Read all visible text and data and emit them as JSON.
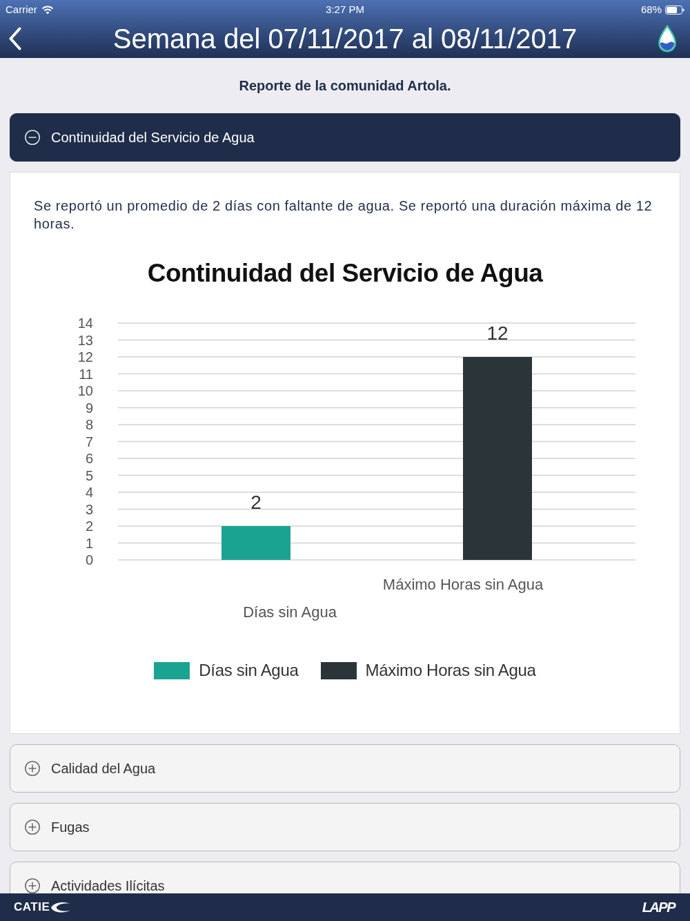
{
  "status_bar": {
    "carrier": "Carrier",
    "time": "3:27 PM",
    "battery": "68%"
  },
  "nav_bar": {
    "title": "Semana del 07/11/2017 al 08/11/2017"
  },
  "subtitle": "Reporte de la comunidad Artola.",
  "sections": [
    {
      "title": "Continuidad del Servicio de Agua",
      "expanded": true,
      "summary": "Se reportó un promedio de 2 días con faltante de agua. Se reportó una duración máxima de 12 horas.",
      "chart_data": {
        "type": "bar",
        "title": "Continuidad del Servicio de Agua",
        "categories": [
          "Días sin Agua",
          "Máximo Horas sin Agua"
        ],
        "series": [
          {
            "name": "Días sin Agua",
            "color": "#1ba392",
            "values": [
              2,
              null
            ]
          },
          {
            "name": "Máximo Horas sin Agua",
            "color": "#2b3539",
            "values": [
              null,
              12
            ]
          }
        ],
        "ylim": [
          0,
          14
        ],
        "yticks": [
          0,
          1,
          2,
          3,
          4,
          5,
          6,
          7,
          8,
          9,
          10,
          11,
          12,
          13,
          14
        ],
        "grid": true,
        "data_labels": true
      }
    },
    {
      "title": "Calidad del Agua",
      "expanded": false
    },
    {
      "title": "Fugas",
      "expanded": false
    },
    {
      "title": "Actividades Ilícitas",
      "expanded": false
    }
  ],
  "footer": {
    "left_logo": "CATIE",
    "right_logo": "LAPP"
  }
}
